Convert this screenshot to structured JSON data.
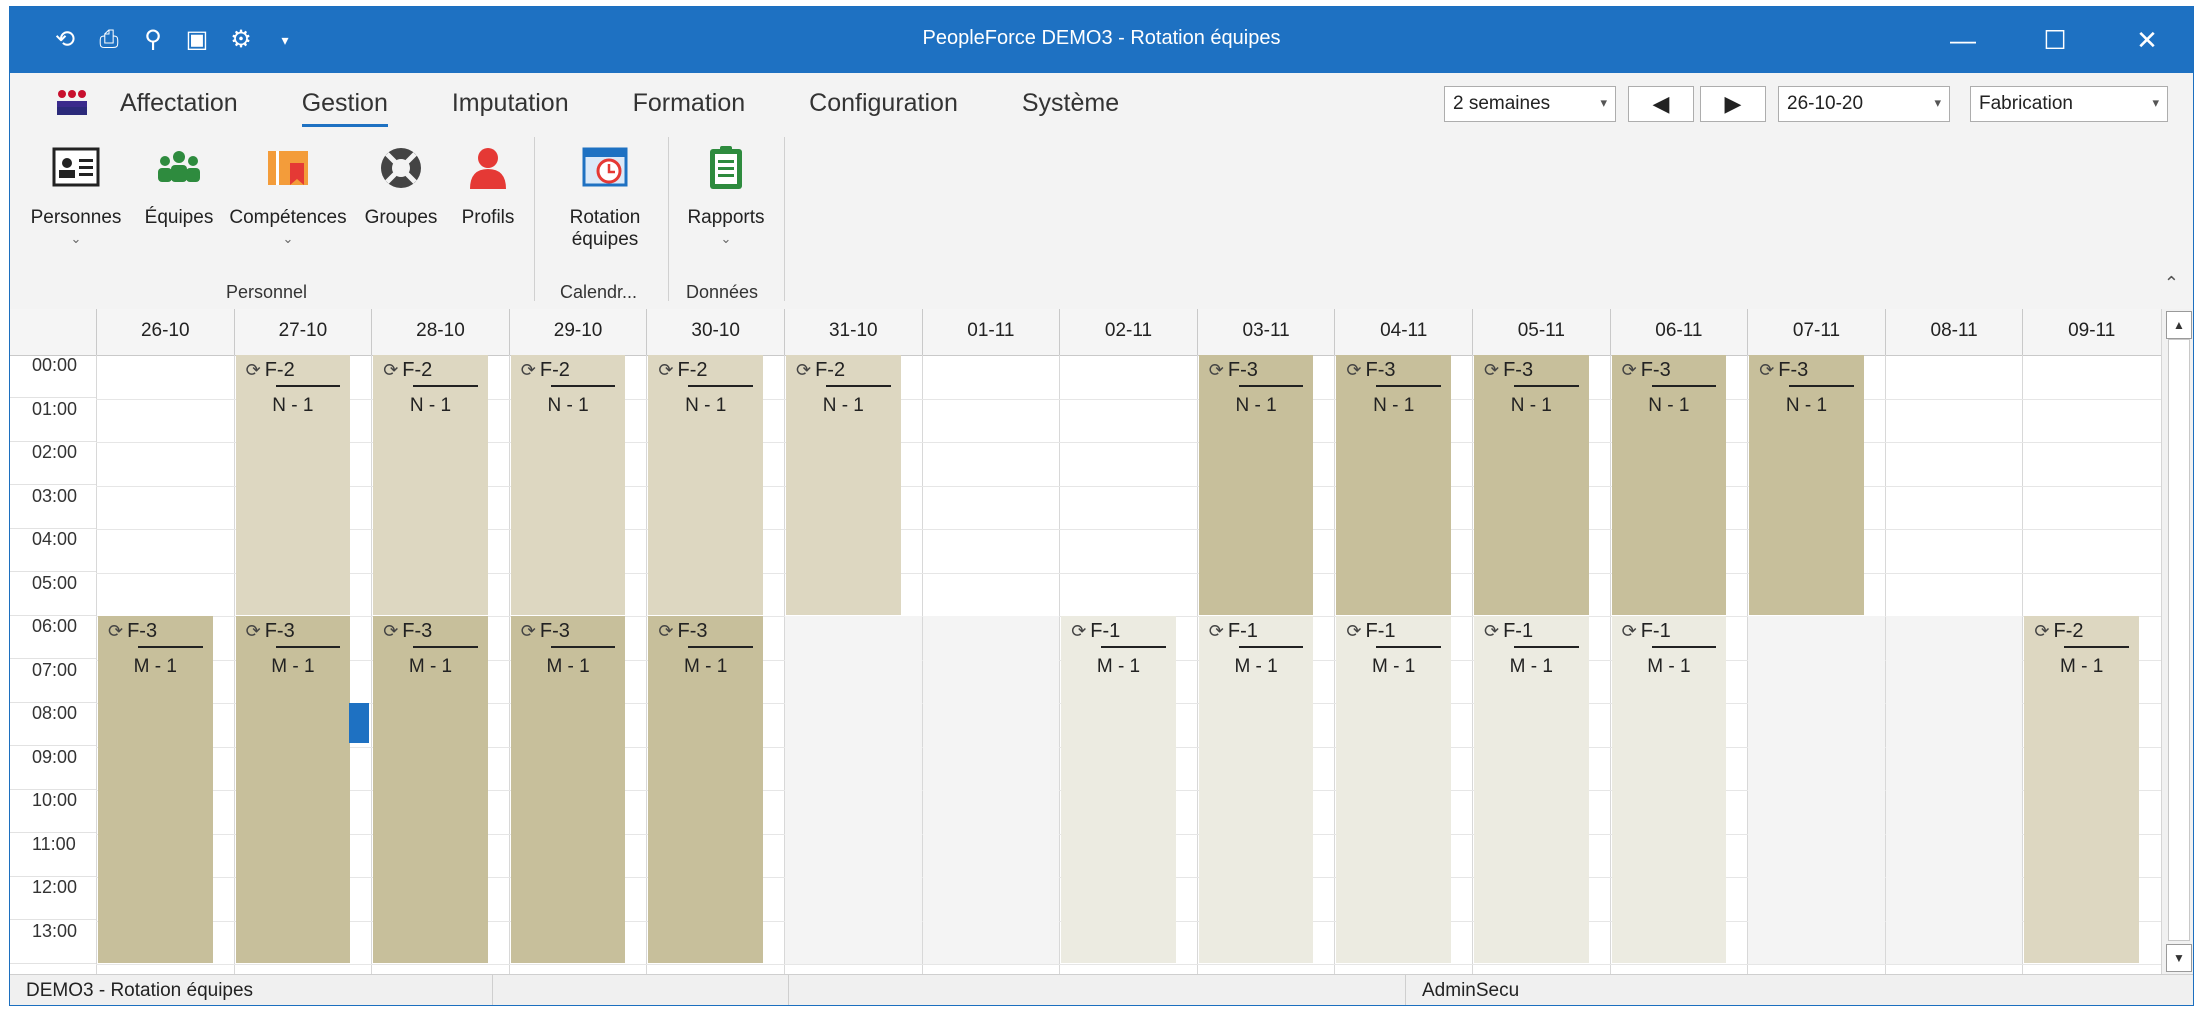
{
  "window": {
    "title": "PeopleForce DEMO3 - Rotation équipes"
  },
  "quick_access": [
    "refresh-icon",
    "print-icon",
    "search-icon",
    "save-icon",
    "settings-icon",
    "dropdown-icon"
  ],
  "menu": {
    "tabs": [
      "Affectation",
      "Gestion",
      "Imputation",
      "Formation",
      "Configuration",
      "Système"
    ],
    "active": "Gestion"
  },
  "toolbar": {
    "period": "2 semaines",
    "date": "26-10-20",
    "department": "Fabrication",
    "prev": "◀",
    "next": "▶"
  },
  "ribbon": {
    "buttons": [
      {
        "label": "Personnes",
        "icon": "person-card-icon",
        "has_dropdown": true
      },
      {
        "label": "Équipes",
        "icon": "team-icon",
        "has_dropdown": false
      },
      {
        "label": "Compétences",
        "icon": "skills-icon",
        "has_dropdown": true
      },
      {
        "label": "Groupes",
        "icon": "lifebuoy-icon",
        "has_dropdown": false
      },
      {
        "label": "Profils",
        "icon": "user-profile-icon",
        "has_dropdown": false
      },
      {
        "label": "Rotation équipes",
        "icon": "rotation-calendar-icon",
        "has_dropdown": false
      },
      {
        "label": "Rapports",
        "icon": "clipboard-icon",
        "has_dropdown": true
      }
    ],
    "groups": [
      "Personnel",
      "Calendr...",
      "Données"
    ]
  },
  "calendar": {
    "days": [
      "26-10",
      "27-10",
      "28-10",
      "29-10",
      "30-10",
      "31-10",
      "01-11",
      "02-11",
      "03-11",
      "04-11",
      "05-11",
      "06-11",
      "07-11",
      "08-11",
      "09-11"
    ],
    "hours": [
      "00:00",
      "01:00",
      "02:00",
      "03:00",
      "04:00",
      "05:00",
      "06:00",
      "07:00",
      "08:00",
      "09:00",
      "10:00",
      "11:00",
      "12:00",
      "13:00"
    ],
    "shifts": [
      {
        "day": 1,
        "start": 0,
        "end": 6,
        "code": "F-2",
        "sub": "N - 1",
        "tone": "mid"
      },
      {
        "day": 2,
        "start": 0,
        "end": 6,
        "code": "F-2",
        "sub": "N - 1",
        "tone": "mid"
      },
      {
        "day": 3,
        "start": 0,
        "end": 6,
        "code": "F-2",
        "sub": "N - 1",
        "tone": "mid"
      },
      {
        "day": 4,
        "start": 0,
        "end": 6,
        "code": "F-2",
        "sub": "N - 1",
        "tone": "mid"
      },
      {
        "day": 5,
        "start": 0,
        "end": 6,
        "code": "F-2",
        "sub": "N - 1",
        "tone": "mid"
      },
      {
        "day": 8,
        "start": 0,
        "end": 6,
        "code": "F-3",
        "sub": "N - 1",
        "tone": "dark"
      },
      {
        "day": 9,
        "start": 0,
        "end": 6,
        "code": "F-3",
        "sub": "N - 1",
        "tone": "dark"
      },
      {
        "day": 10,
        "start": 0,
        "end": 6,
        "code": "F-3",
        "sub": "N - 1",
        "tone": "dark"
      },
      {
        "day": 11,
        "start": 0,
        "end": 6,
        "code": "F-3",
        "sub": "N - 1",
        "tone": "dark"
      },
      {
        "day": 12,
        "start": 0,
        "end": 6,
        "code": "F-3",
        "sub": "N - 1",
        "tone": "dark"
      },
      {
        "day": 0,
        "start": 6,
        "end": 14,
        "code": "F-3",
        "sub": "M - 1",
        "tone": "dark"
      },
      {
        "day": 1,
        "start": 6,
        "end": 14,
        "code": "F-3",
        "sub": "M - 1",
        "tone": "dark"
      },
      {
        "day": 2,
        "start": 6,
        "end": 14,
        "code": "F-3",
        "sub": "M - 1",
        "tone": "dark"
      },
      {
        "day": 3,
        "start": 6,
        "end": 14,
        "code": "F-3",
        "sub": "M - 1",
        "tone": "dark"
      },
      {
        "day": 4,
        "start": 6,
        "end": 14,
        "code": "F-3",
        "sub": "M - 1",
        "tone": "dark"
      },
      {
        "day": 7,
        "start": 6,
        "end": 14,
        "code": "F-1",
        "sub": "M - 1",
        "tone": "light"
      },
      {
        "day": 8,
        "start": 6,
        "end": 14,
        "code": "F-1",
        "sub": "M - 1",
        "tone": "light"
      },
      {
        "day": 9,
        "start": 6,
        "end": 14,
        "code": "F-1",
        "sub": "M - 1",
        "tone": "light"
      },
      {
        "day": 10,
        "start": 6,
        "end": 14,
        "code": "F-1",
        "sub": "M - 1",
        "tone": "light"
      },
      {
        "day": 11,
        "start": 6,
        "end": 14,
        "code": "F-1",
        "sub": "M - 1",
        "tone": "light"
      },
      {
        "day": 14,
        "start": 6,
        "end": 14,
        "code": "F-2",
        "sub": "M - 1",
        "tone": "mid"
      }
    ]
  },
  "status": {
    "left": "DEMO3 - Rotation équipes",
    "right": "AdminSecu"
  }
}
